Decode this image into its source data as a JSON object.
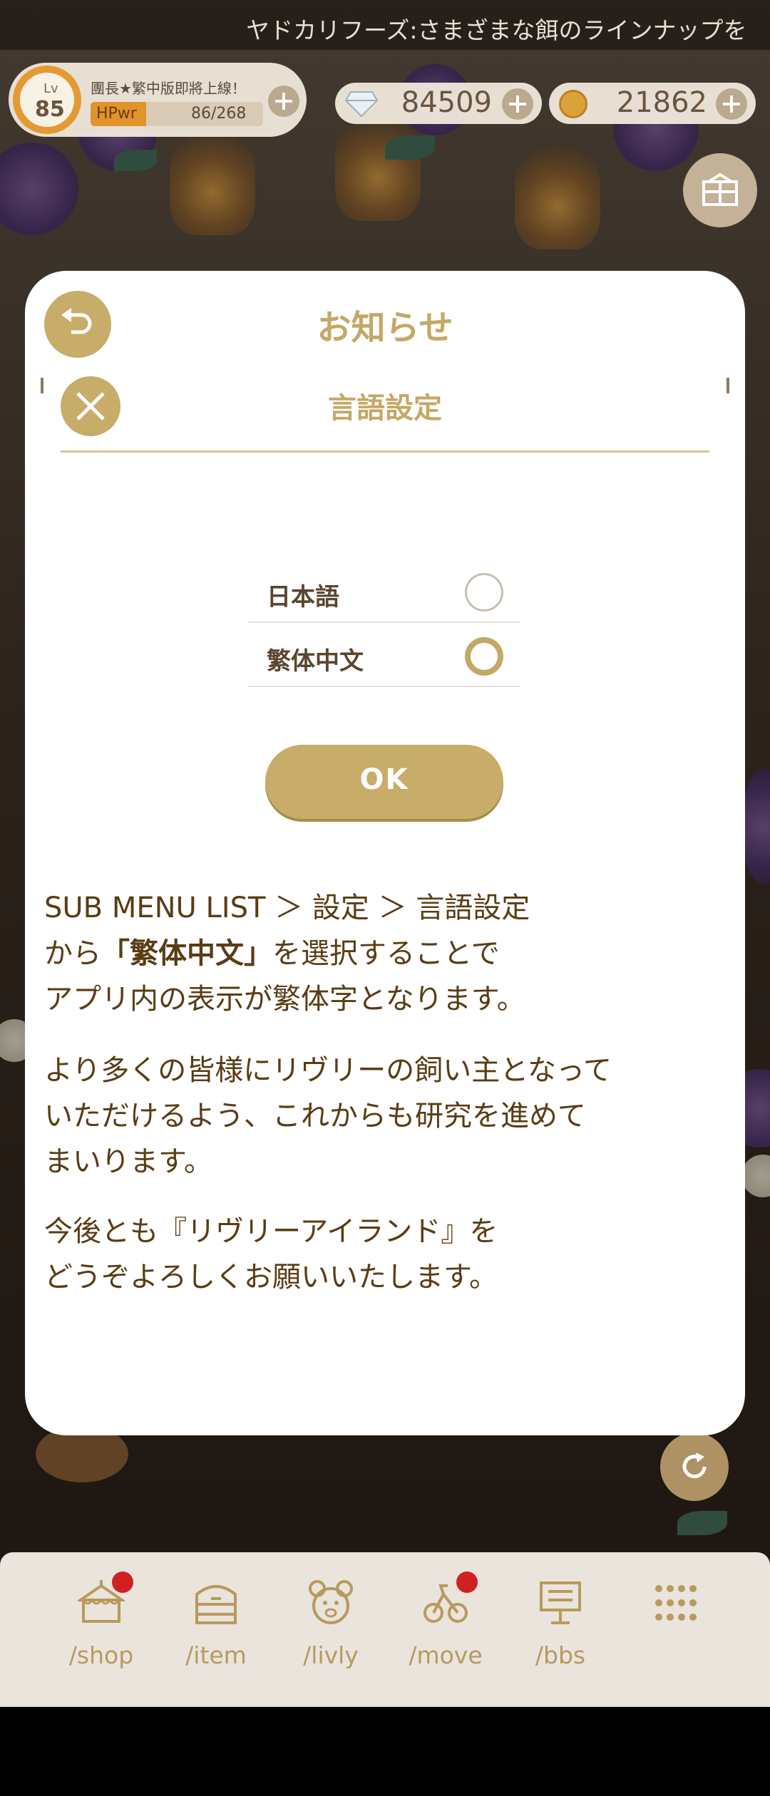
{
  "ticker": {
    "text": "ヤドカリフーズ:さまざまな餌のラインナップを"
  },
  "hud": {
    "level_label": "Lv",
    "level": "85",
    "guild_text": "團長★繁中版即將上線！",
    "hp_label": "HPwr",
    "hp_value": "86/268",
    "hp_current": 86,
    "hp_max": 268,
    "gems": "84509",
    "coins": "21862",
    "gem_icon": "diamond-icon",
    "coin_icon": "coin-icon"
  },
  "modal": {
    "title": "お知らせ",
    "sub_title": "言語設定",
    "languages": [
      {
        "label": "日本語",
        "selected": false
      },
      {
        "label": "繁体中文",
        "selected": true
      }
    ],
    "ok_label": "OK",
    "para1": {
      "line1": "SUB MENU LIST ＞ 設定 ＞ 言語設定",
      "line2_prefix": "から",
      "line2_bold": "「繁体中文」",
      "line2_suffix": "を選択することで",
      "line3": "アプリ内の表示が繁体字となります。"
    },
    "para2": {
      "line1": "より多くの皆様にリヴリーの飼い主となって",
      "line2": "いただけるよう、これからも研究を進めて",
      "line3": "まいります。"
    },
    "para3": {
      "line1": "今後とも『リヴリーアイランド』を",
      "line2": "どうぞよろしくお願いいたします。"
    }
  },
  "nav": [
    {
      "label": "/shop",
      "icon": "shop-icon",
      "badge": true
    },
    {
      "label": "/item",
      "icon": "item-icon",
      "badge": false
    },
    {
      "label": "/livly",
      "icon": "livly-icon",
      "badge": false
    },
    {
      "label": "/move",
      "icon": "move-icon",
      "badge": true
    },
    {
      "label": "/bbs",
      "icon": "bbs-icon",
      "badge": false
    },
    {
      "label": "",
      "icon": "more-grid-icon",
      "badge": false
    }
  ],
  "colors": {
    "accent": "#c8ac6a",
    "text_brown": "#5a3c14",
    "badge_red": "#cf2121"
  }
}
